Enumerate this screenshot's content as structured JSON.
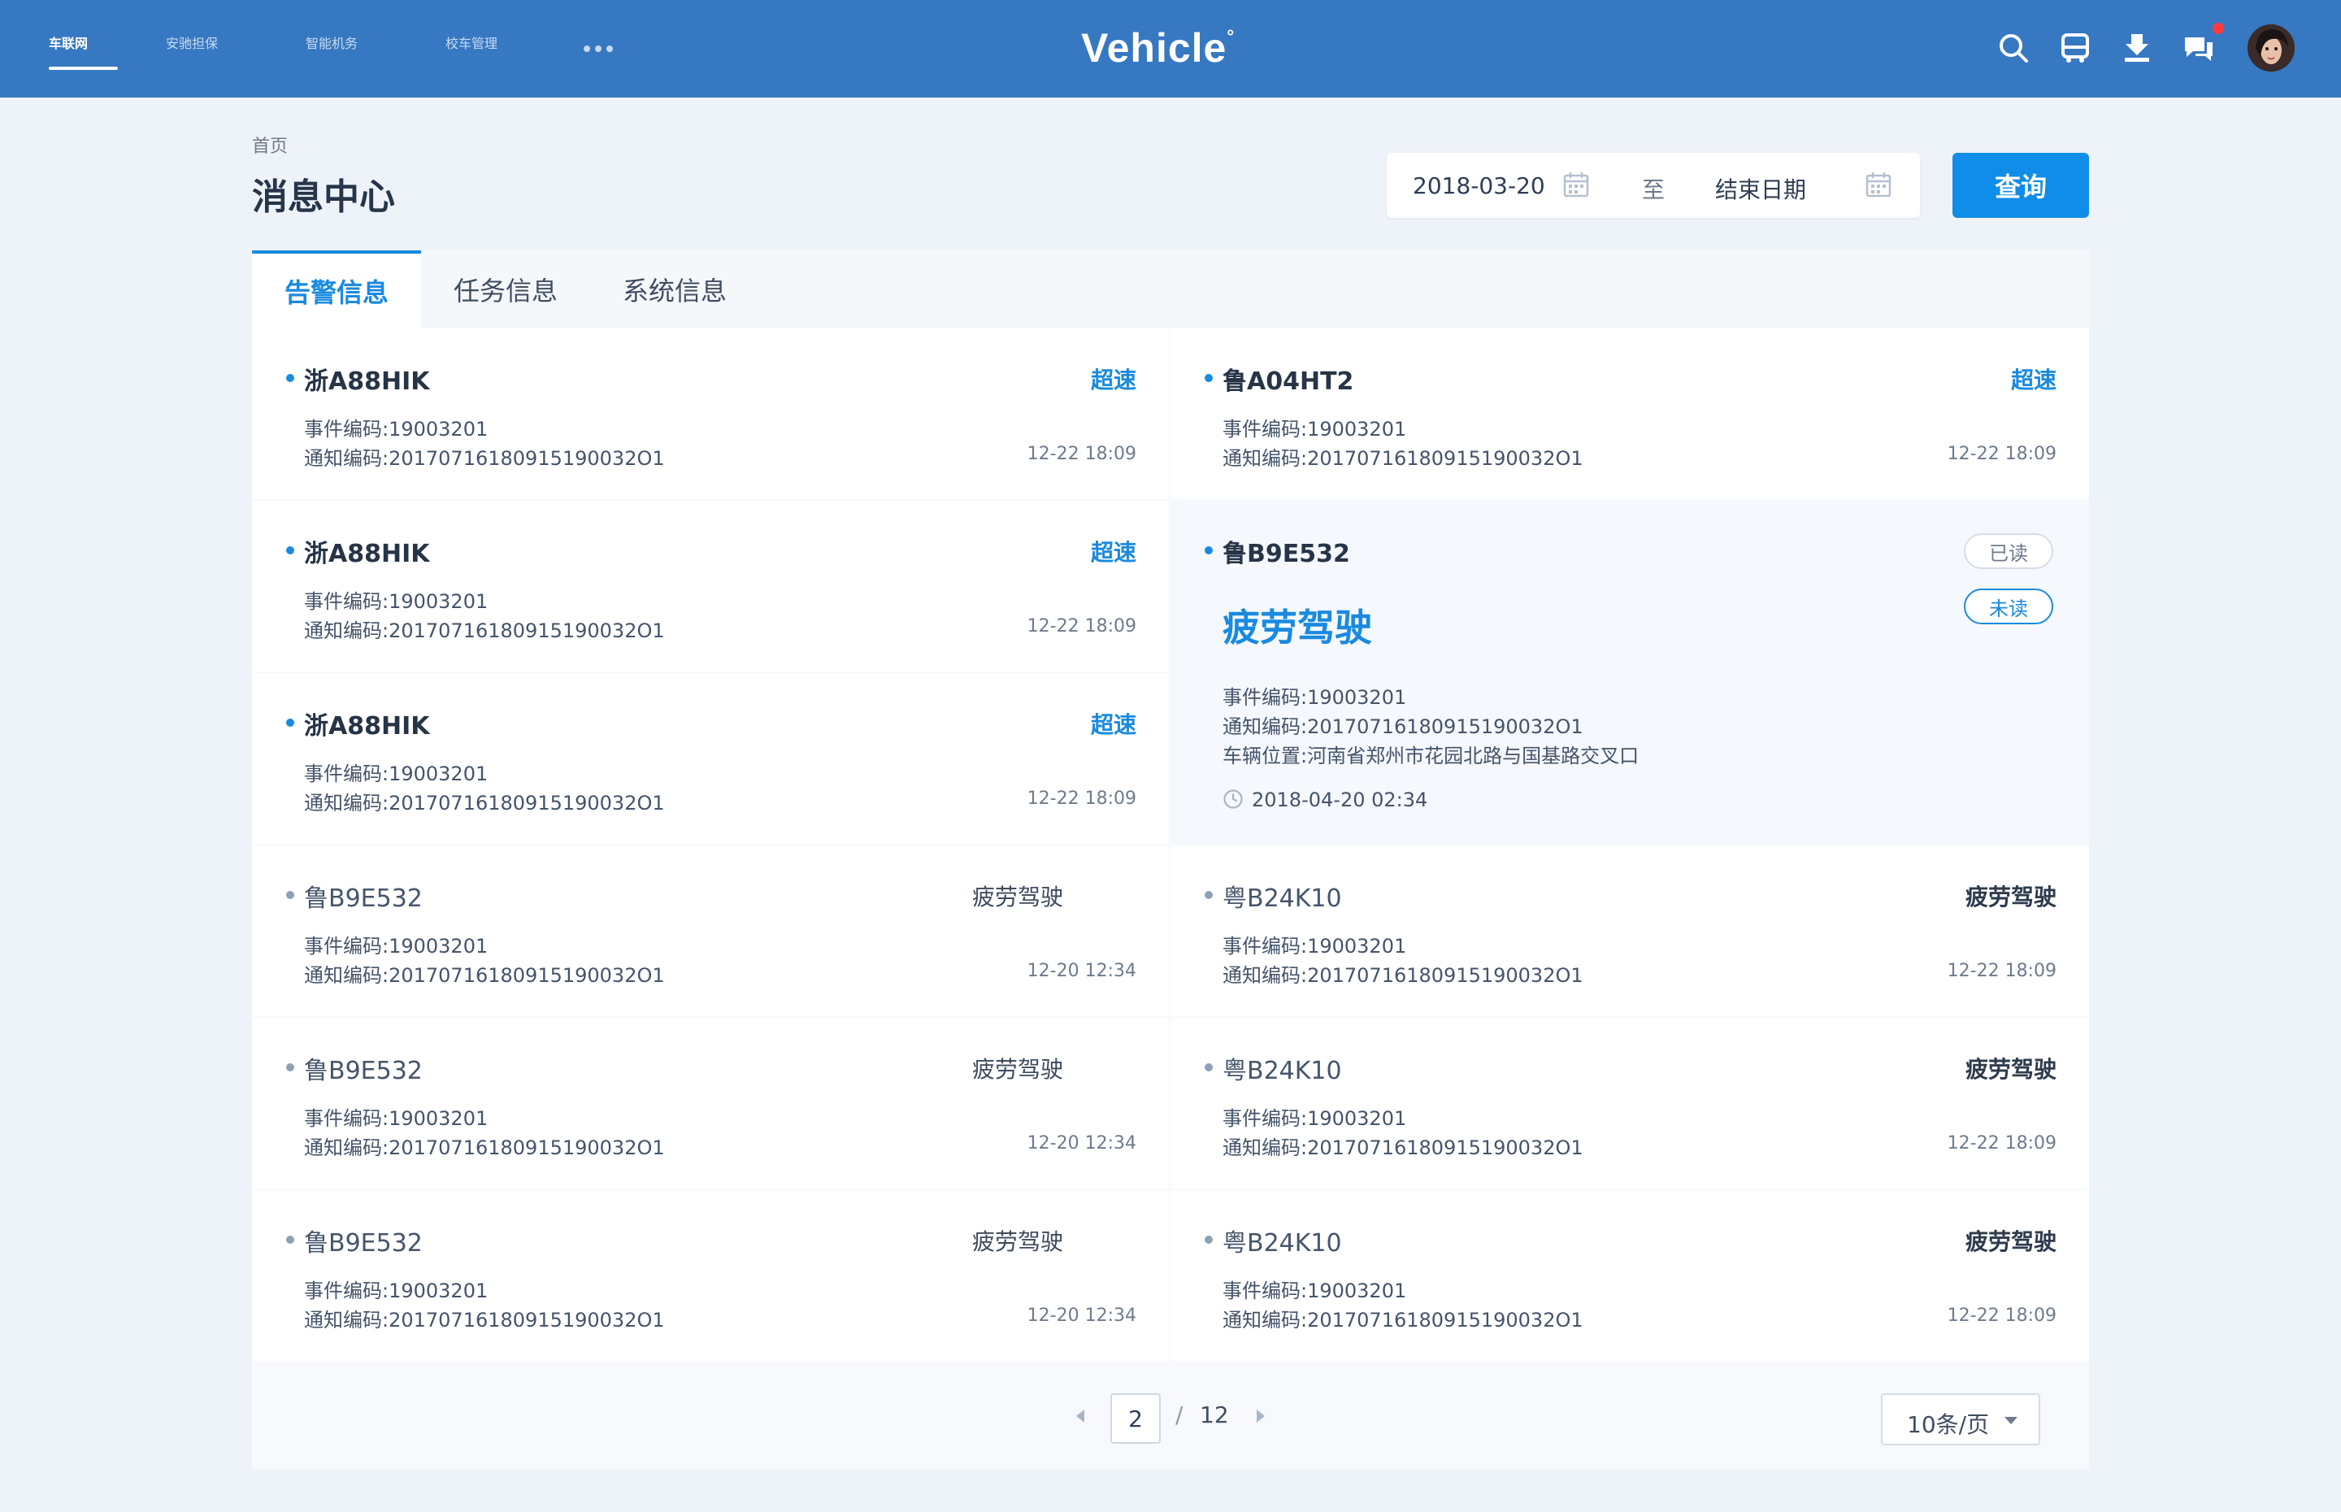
{
  "header": {
    "logo": "Vehicle",
    "logo_mark": "°",
    "nav": [
      "车联网",
      "安驰担保",
      "智能机务",
      "校车管理"
    ],
    "icons": [
      "search-icon",
      "bus-icon",
      "download-icon",
      "chat-icon",
      "avatar"
    ]
  },
  "breadcrumb": "首页",
  "page_title": "消息中心",
  "filter": {
    "start_date": "2018-03-20",
    "separator": "至",
    "end_placeholder": "结束日期",
    "query_label": "查询"
  },
  "tabs": [
    "告警信息",
    "任务信息",
    "系统信息"
  ],
  "cards": [
    {
      "plate": "浙A88HIK",
      "tag": "超速",
      "event": "事件编码:19003201",
      "notice": "通知编码:20170716180915190032O1",
      "time": "12-22 18:09",
      "status": "unread"
    },
    {
      "plate": "鲁A04HT2",
      "tag": "超速",
      "event": "事件编码:19003201",
      "notice": "通知编码:20170716180915190032O1",
      "time": "12-22 18:09",
      "status": "unread"
    },
    {
      "plate": "浙A88HIK",
      "tag": "超速",
      "event": "事件编码:19003201",
      "notice": "通知编码:20170716180915190032O1",
      "time": "12-22 18:09",
      "status": "unread"
    },
    {
      "plate": "浙A88HIK",
      "tag": "超速",
      "event": "事件编码:19003201",
      "notice": "通知编码:20170716180915190032O1",
      "time": "12-22 18:09",
      "status": "unread"
    },
    {
      "plate": "鲁B9E532",
      "tag": "疲劳驾驶",
      "event": "事件编码:19003201",
      "notice": "通知编码:20170716180915190032O1",
      "time": "12-20 12:34",
      "status": "read"
    },
    {
      "plate": "粤B24K10",
      "tag": "疲劳驾驶",
      "event": "事件编码:19003201",
      "notice": "通知编码:20170716180915190032O1",
      "time": "12-22 18:09",
      "status": "read"
    },
    {
      "plate": "鲁B9E532",
      "tag": "疲劳驾驶",
      "event": "事件编码:19003201",
      "notice": "通知编码:20170716180915190032O1",
      "time": "12-20 12:34",
      "status": "read"
    },
    {
      "plate": "粤B24K10",
      "tag": "疲劳驾驶",
      "event": "事件编码:19003201",
      "notice": "通知编码:20170716180915190032O1",
      "time": "12-22 18:09",
      "status": "read"
    },
    {
      "plate": "鲁B9E532",
      "tag": "疲劳驾驶",
      "event": "事件编码:19003201",
      "notice": "通知编码:20170716180915190032O1",
      "time": "12-20 12:34",
      "status": "read"
    },
    {
      "plate": "粤B24K10",
      "tag": "疲劳驾驶",
      "event": "事件编码:19003201",
      "notice": "通知编码:20170716180915190032O1",
      "time": "12-22 18:09",
      "status": "read"
    }
  ],
  "detail": {
    "plate": "鲁B9E532",
    "read_label": "已读",
    "unread_label": "未读",
    "big_tag": "疲劳驾驶",
    "event": "事件编码:19003201",
    "notice": "通知编码:20170716180915190032O1",
    "location": "车辆位置:河南省郑州市花园北路与国基路交叉口",
    "timestamp": "2018-04-20  02:34"
  },
  "pagination": {
    "current": "2",
    "separator": "/",
    "total": "12",
    "per_page": "10条/页"
  },
  "colors": {
    "header_bg": "#3778c2",
    "accent": "#1a8ae0",
    "button": "#0f8de8",
    "notification_dot": "#ff3b3b",
    "page_bg": "#eef3f9"
  }
}
